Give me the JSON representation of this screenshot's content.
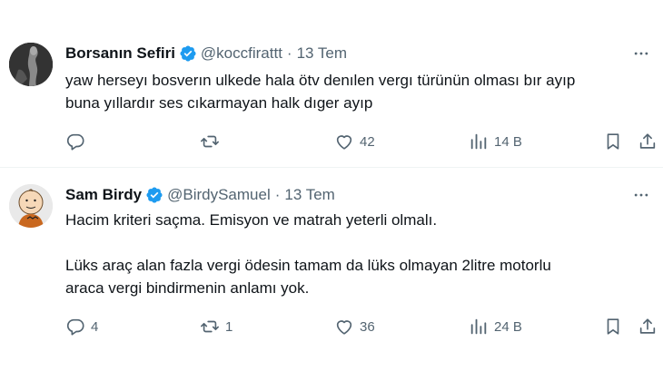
{
  "tweets": [
    {
      "display_name": "Borsanın Sefiri",
      "handle": "@koccfirattt",
      "separator": "·",
      "date": "13 Tem",
      "text_lines": [
        "yaw herseyı bosverın ulkede hala ötv denılen vergı türünün olması bır ayıp",
        "buna yıllardır ses cıkarmayan halk dıger ayıp"
      ],
      "actions": {
        "replies": "",
        "retweets": "",
        "likes": "42",
        "views": "14 B"
      }
    },
    {
      "display_name": "Sam Birdy",
      "handle": "@BirdySamuel",
      "separator": "·",
      "date": "13 Tem",
      "paragraphs": [
        [
          "Hacim kriteri saçma. Emisyon ve matrah yeterli olmalı."
        ],
        [
          "Lüks araç alan fazla vergi ödesin tamam da lüks olmayan 2litre motorlu",
          "araca vergi bindirmenin anlamı yok."
        ]
      ],
      "actions": {
        "replies": "4",
        "retweets": "1",
        "likes": "36",
        "views": "24 B"
      }
    }
  ],
  "icons": {
    "verified": "verified-badge-icon",
    "more": "more-dots-icon",
    "reply": "reply-icon",
    "retweet": "retweet-icon",
    "like": "heart-icon",
    "views": "views-chart-icon",
    "bookmark": "bookmark-icon",
    "share": "share-icon"
  },
  "colors": {
    "text_primary": "#0f1419",
    "text_secondary": "#536471",
    "verified_blue": "#1d9bf0",
    "divider": "#eff3f4"
  }
}
